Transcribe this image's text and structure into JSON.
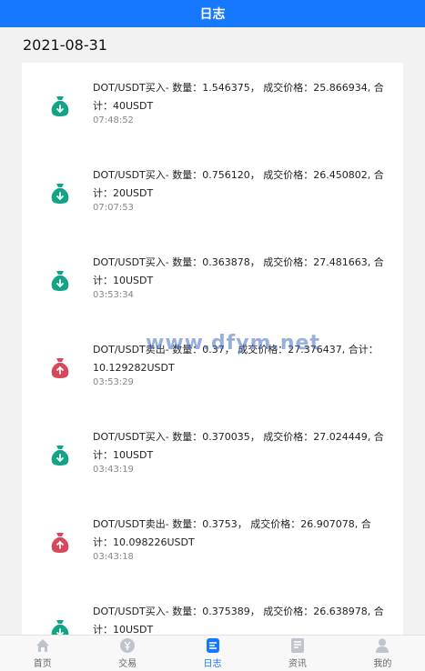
{
  "header": {
    "title": "日志"
  },
  "date": "2021-08-31",
  "watermark": "www.dfym.net",
  "colors": {
    "buy": "#11a683",
    "sell": "#d9475c",
    "accent": "#1677ff"
  },
  "logs": [
    {
      "type": "buy",
      "icon": "money-bag-down-icon",
      "text": "DOT/USDT买入- 数量：1.546375， 成交价格：25.866934, 合计：40USDT",
      "time": "07:48:52"
    },
    {
      "type": "buy",
      "icon": "money-bag-down-icon",
      "text": "DOT/USDT买入- 数量：0.756120， 成交价格：26.450802, 合计：20USDT",
      "time": "07:07:53"
    },
    {
      "type": "buy",
      "icon": "money-bag-down-icon",
      "text": "DOT/USDT买入- 数量：0.363878， 成交价格：27.481663, 合计：10USDT",
      "time": "03:53:34"
    },
    {
      "type": "sell",
      "icon": "money-bag-up-icon",
      "text": "DOT/USDT卖出- 数量：0.37， 成交价格：27.376437, 合计：10.129282USDT",
      "time": "03:53:29"
    },
    {
      "type": "buy",
      "icon": "money-bag-down-icon",
      "text": "DOT/USDT买入- 数量：0.370035， 成交价格：27.024449, 合计：10USDT",
      "time": "03:43:19"
    },
    {
      "type": "sell",
      "icon": "money-bag-up-icon",
      "text": "DOT/USDT卖出- 数量：0.3753， 成交价格：26.907078, 合计：10.098226USDT",
      "time": "03:43:18"
    },
    {
      "type": "buy",
      "icon": "money-bag-down-icon",
      "text": "DOT/USDT买入- 数量：0.375389， 成交价格：26.638978, 合计：10USDT",
      "time": ""
    }
  ],
  "tabs": [
    {
      "label": "首页",
      "icon": "home-icon",
      "active": false
    },
    {
      "label": "交易",
      "icon": "trade-icon",
      "active": false
    },
    {
      "label": "日志",
      "icon": "log-icon",
      "active": true
    },
    {
      "label": "资讯",
      "icon": "news-icon",
      "active": false
    },
    {
      "label": "我的",
      "icon": "user-icon",
      "active": false
    }
  ]
}
